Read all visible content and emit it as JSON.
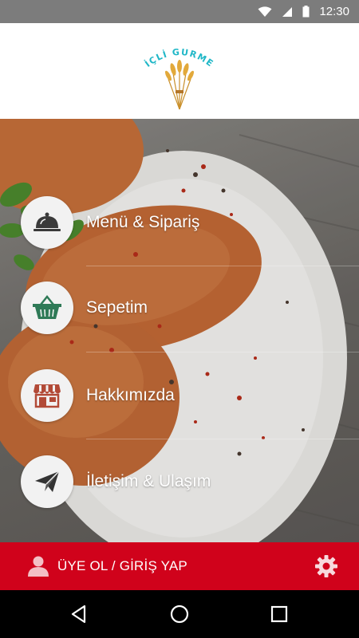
{
  "status_bar": {
    "time": "12:30"
  },
  "header": {
    "logo_text": "İÇLİ GURME"
  },
  "menu": {
    "items": [
      {
        "label": "Menü & Sipariş",
        "icon": "cloche-icon"
      },
      {
        "label": "Sepetim",
        "icon": "basket-icon"
      },
      {
        "label": "Hakkımızda",
        "icon": "store-icon"
      },
      {
        "label": "İletişim & Ulaşım",
        "icon": "paper-plane-icon"
      }
    ]
  },
  "footer": {
    "login_label": "ÜYE OL / GİRİŞ YAP"
  },
  "colors": {
    "accent": "#d0021b",
    "icon_dark": "#3a3a3a",
    "logo_teal": "#1fb7c7",
    "logo_gold": "#d6a033"
  }
}
